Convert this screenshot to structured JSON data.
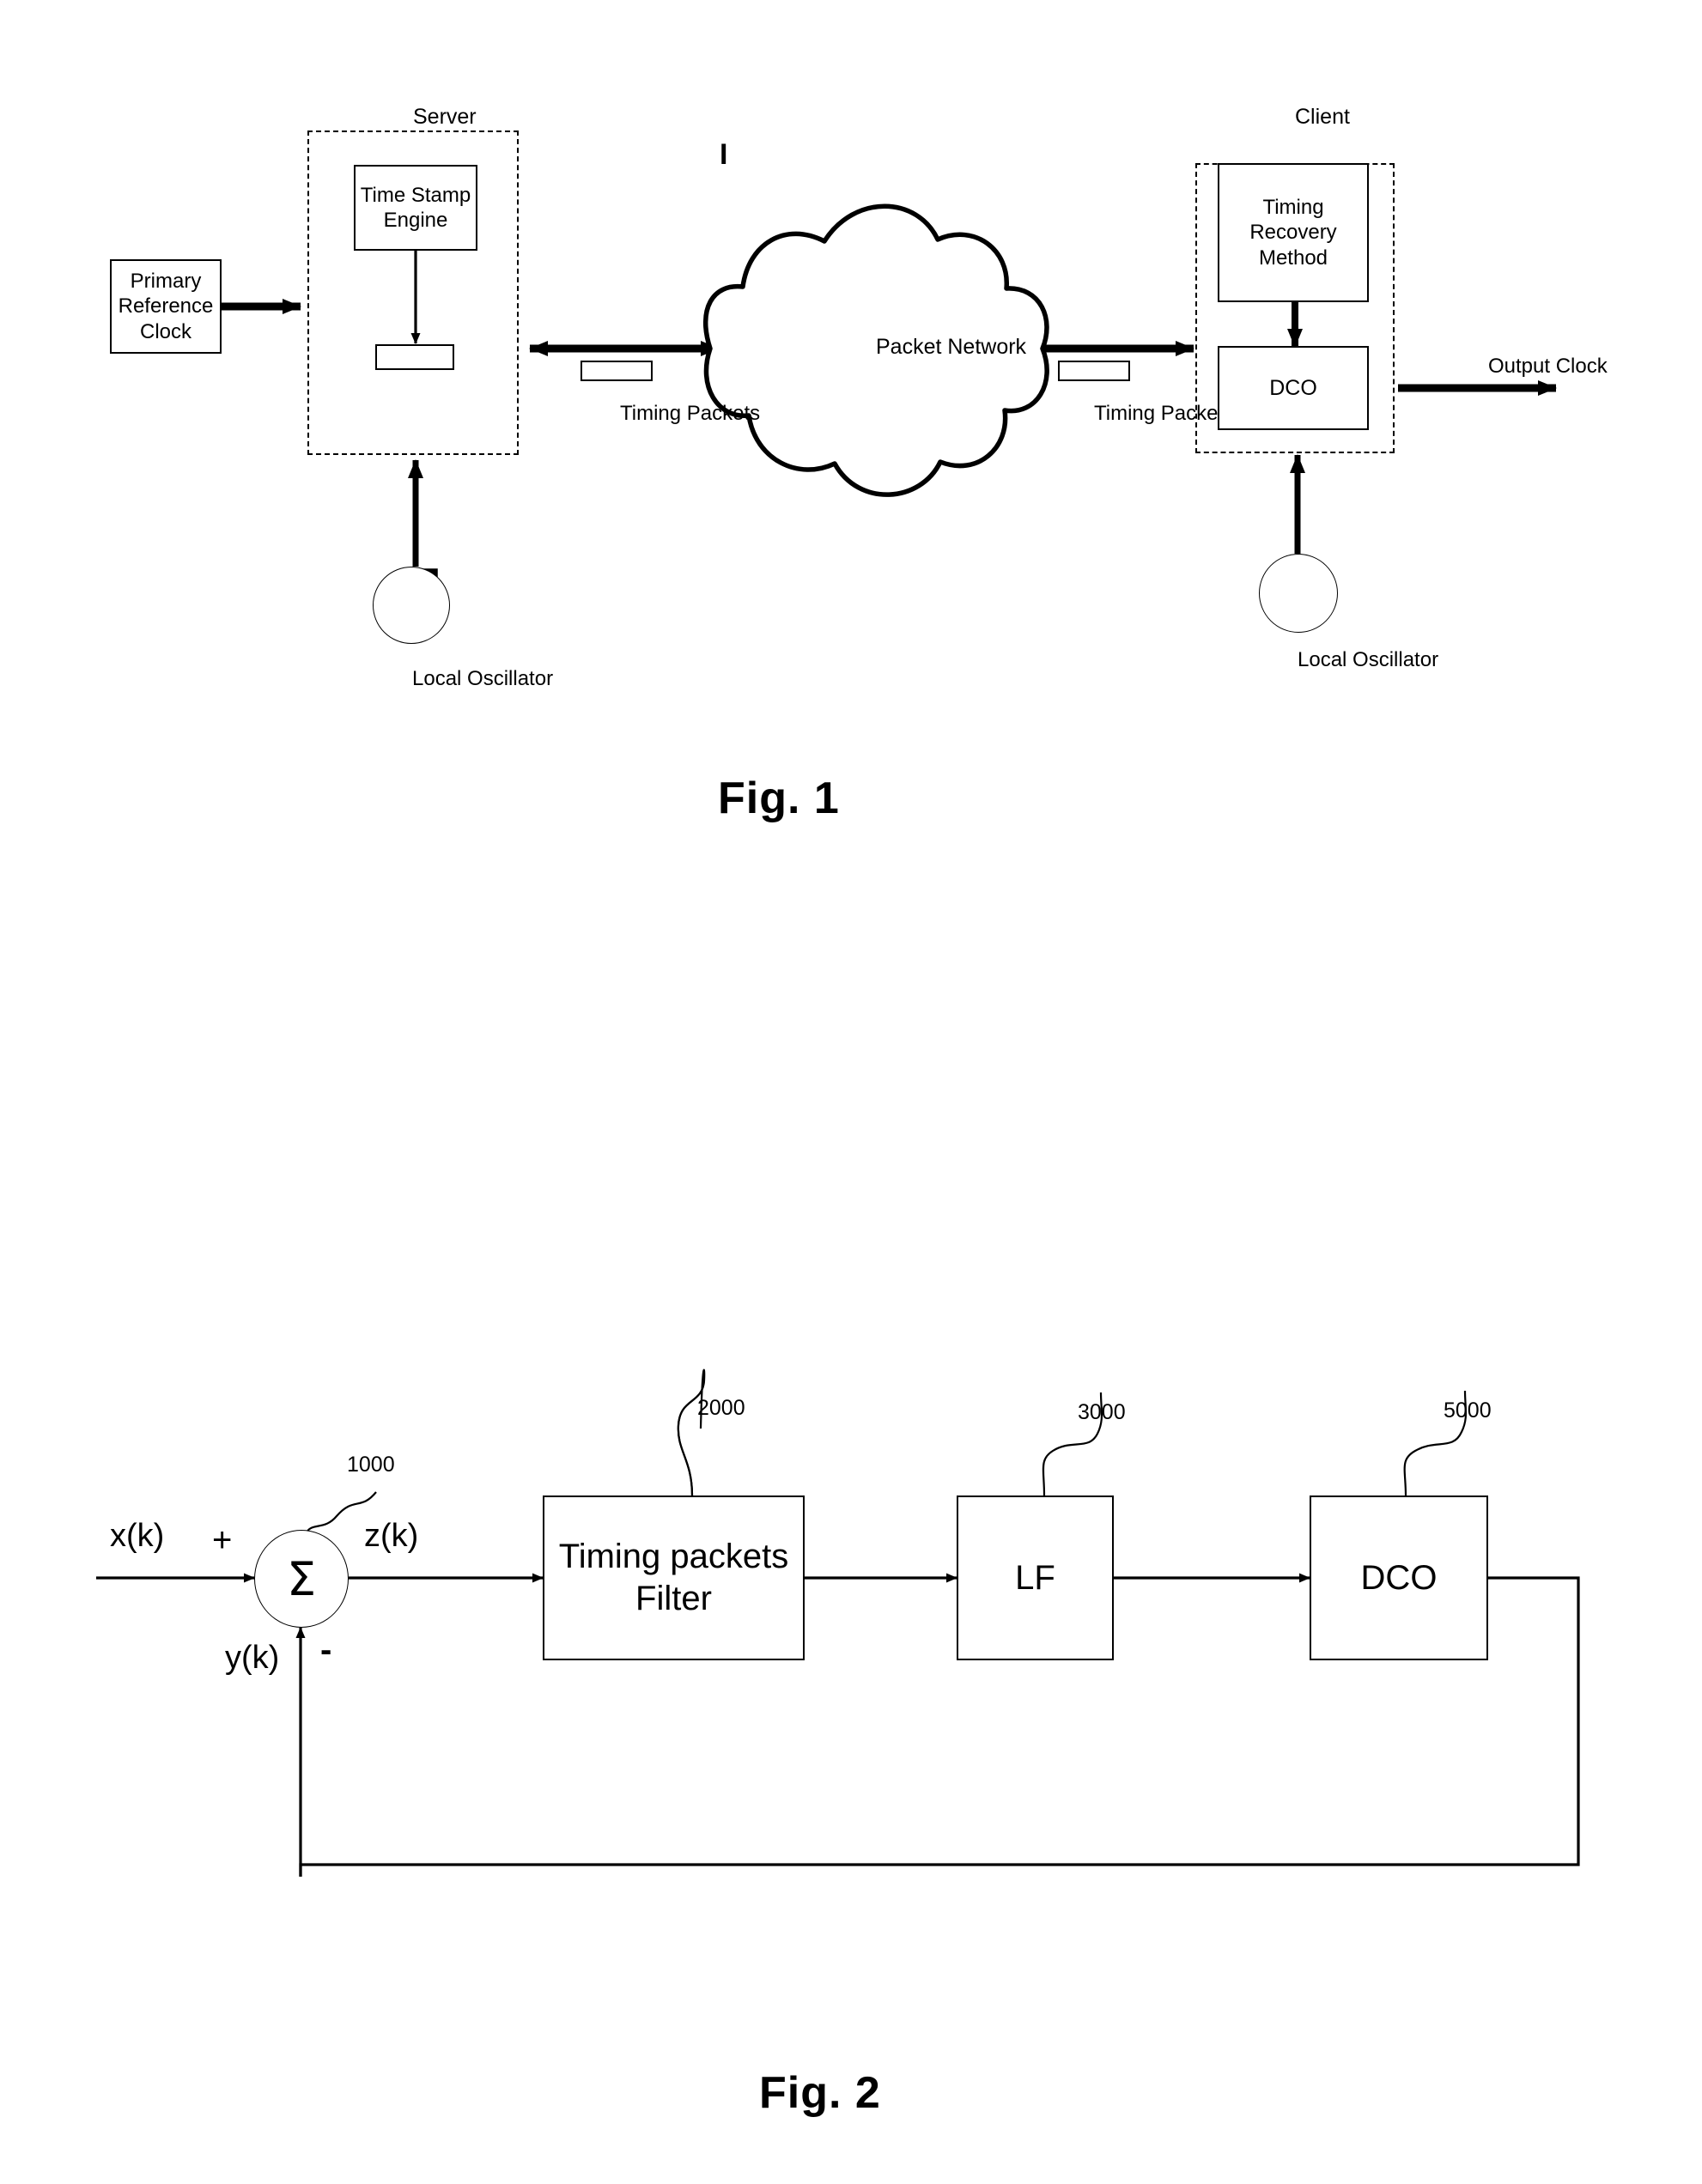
{
  "figures": [
    {
      "id": "fig1",
      "caption": "Fig. 1",
      "title_server": "Server",
      "title_client": "Client",
      "nodes": {
        "primary_reference_clock": "Primary\nReference\nClock",
        "time_stamp_engine": "Time Stamp\nEngine",
        "packet_network": "Packet Network",
        "timing_recovery_method": "Timing\nRecovery\nMethod",
        "dco": "DCO",
        "server_packet_buffer": "",
        "client_packet_buffer": ""
      },
      "labels": {
        "timing_packets_left": "Timing Packets",
        "timing_packets_right": "Timing Packets",
        "output_clock": "Output Clock",
        "local_oscillator_server": "Local Oscillator",
        "local_oscillator_client": "Local Oscillator",
        "tick_mark": "I"
      }
    },
    {
      "id": "fig2",
      "caption": "Fig. 2",
      "blocks": [
        {
          "label": "Timing packets\nFilter",
          "ref": "2000"
        },
        {
          "label": "LF",
          "ref": "3000"
        },
        {
          "label": "DCO",
          "ref": "5000"
        }
      ],
      "summer": {
        "symbol": "Σ",
        "ref": "1000",
        "plus_sign": "+",
        "minus_sign": "-"
      },
      "signals": {
        "input": "x(k)",
        "error": "z(k)",
        "feedback": "y(k)"
      }
    }
  ],
  "colors": {
    "stroke": "#000000",
    "background": "#ffffff"
  }
}
